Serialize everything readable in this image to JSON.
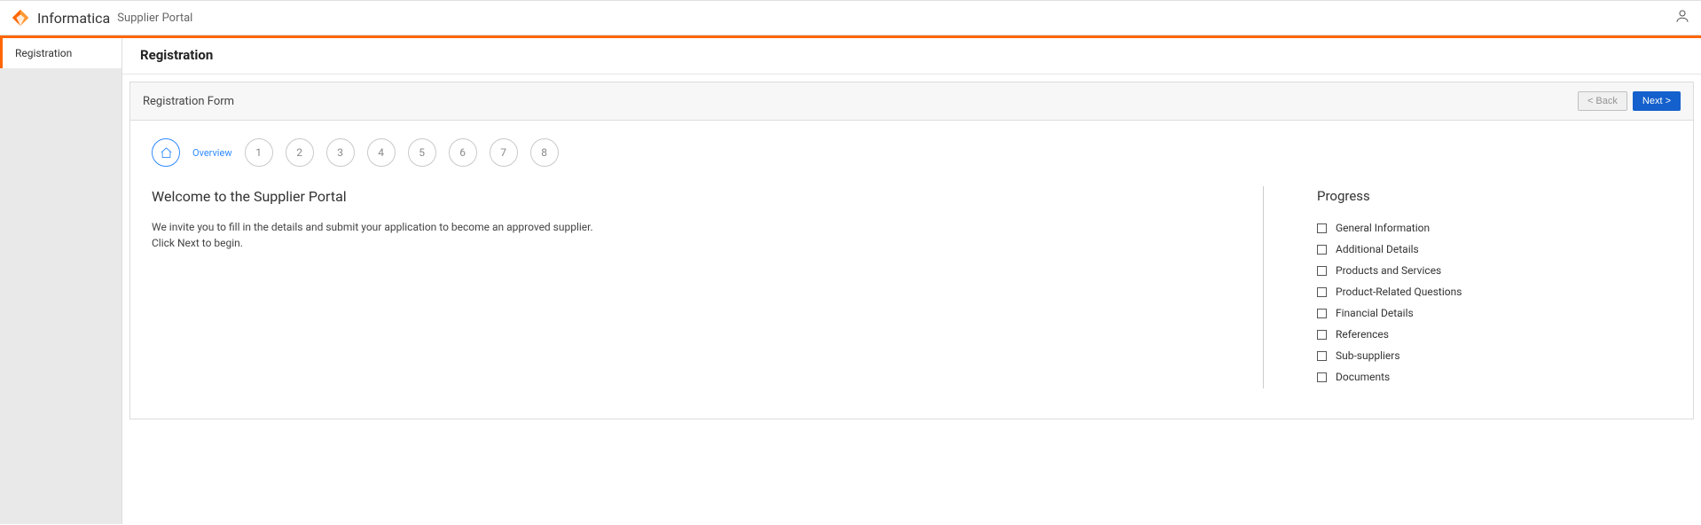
{
  "header": {
    "brand": "Informatica",
    "app_name": "Supplier Portal"
  },
  "sidebar": {
    "items": [
      {
        "label": "Registration"
      }
    ]
  },
  "page": {
    "title": "Registration"
  },
  "form": {
    "card_title": "Registration Form",
    "back_label": "< Back",
    "next_label": "Next >",
    "stepper": {
      "overview_label": "Overview",
      "steps": [
        "1",
        "2",
        "3",
        "4",
        "5",
        "6",
        "7",
        "8"
      ]
    },
    "welcome": {
      "heading": "Welcome to the Supplier Portal",
      "line1": "We invite you to fill in the details and submit your application to become an approved supplier.",
      "line2": "Click Next to begin."
    },
    "progress": {
      "heading": "Progress",
      "items": [
        "General Information",
        "Additional Details",
        "Products and Services",
        "Product-Related Questions",
        "Financial Details",
        "References",
        "Sub-suppliers",
        "Documents"
      ]
    }
  }
}
